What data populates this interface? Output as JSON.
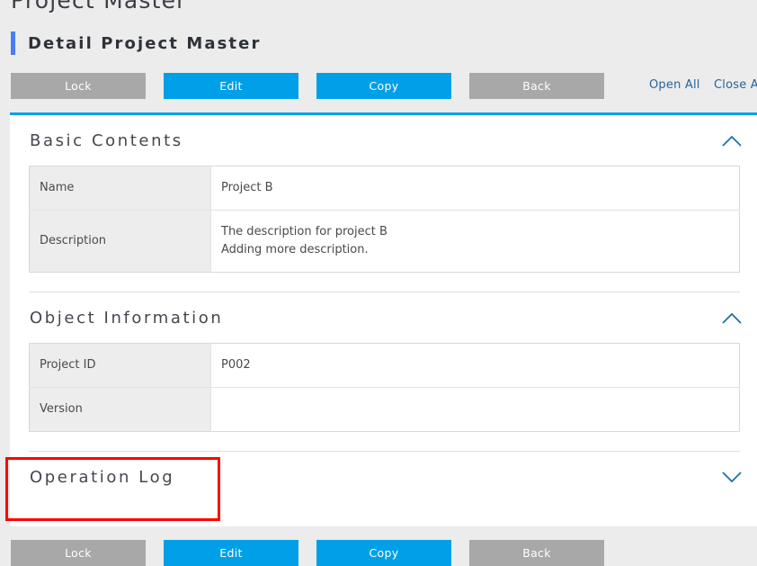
{
  "header": {
    "breadcrumb_title": "Project Master",
    "detail_title": "Detail Project Master",
    "accent_color": "#4a7ef0"
  },
  "toolbar": {
    "buttons": [
      {
        "label": "Lock",
        "style": "gray"
      },
      {
        "label": "Edit",
        "style": "blue"
      },
      {
        "label": "Copy",
        "style": "blue"
      },
      {
        "label": "Back",
        "style": "gray"
      }
    ],
    "links": [
      {
        "label": "Open All"
      },
      {
        "label": "Close All"
      }
    ],
    "gray_color": "#a8a8a8",
    "blue_color": "#00a0e9"
  },
  "sections": [
    {
      "title": "Basic Contents",
      "expanded": true,
      "toggle_icon": "chevron-up-icon",
      "rows": [
        {
          "label": "Name",
          "values": [
            "Project B"
          ]
        },
        {
          "label": "Description",
          "values": [
            "The description for project B",
            "Adding more description."
          ]
        }
      ]
    },
    {
      "title": "Object Information",
      "expanded": true,
      "toggle_icon": "chevron-up-icon",
      "rows": [
        {
          "label": "Project ID",
          "values": [
            "P002"
          ]
        },
        {
          "label": "Version",
          "values": [
            ""
          ]
        }
      ]
    },
    {
      "title": "Operation Log",
      "expanded": false,
      "toggle_icon": "chevron-down-icon",
      "rows": []
    }
  ],
  "annotation": {
    "target": "Operation Log",
    "color": "#ff0000"
  },
  "bottom_toolbar": {
    "buttons": [
      {
        "label": "Lock",
        "style": "gray"
      },
      {
        "label": "Edit",
        "style": "blue"
      },
      {
        "label": "Copy",
        "style": "blue"
      },
      {
        "label": "Back",
        "style": "gray"
      }
    ]
  }
}
